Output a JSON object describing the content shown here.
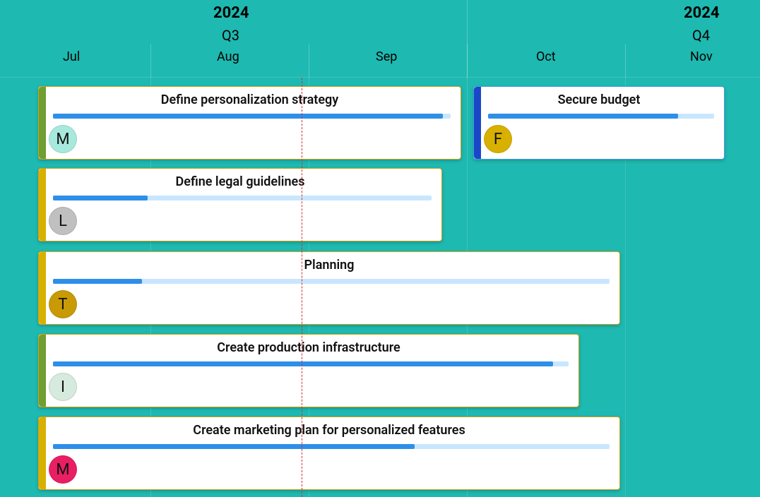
{
  "header": {
    "year_q3": "2024",
    "quarter_q3": "Q3",
    "year_q4": "2024",
    "quarter_q4": "Q4",
    "months": {
      "jul": "Jul",
      "aug": "Aug",
      "sep": "Sep",
      "oct": "Oct",
      "nov": "Nov"
    }
  },
  "tasks": [
    {
      "title": "Define personalization strategy",
      "avatar_letter": "M",
      "avatar_color": "#a7e9dd",
      "edge_color": "#6f9e33",
      "border_color": "#cda312",
      "progress": 98
    },
    {
      "title": "Secure budget",
      "avatar_letter": "F",
      "avatar_color": "#d8b000",
      "edge_color": "#1848c7",
      "border_color": "#4d99e5",
      "progress": 84
    },
    {
      "title": "Define legal guidelines",
      "avatar_letter": "L",
      "avatar_color": "#c0c0c0",
      "edge_color": "#d8b000",
      "border_color": "#cda312",
      "progress": 25
    },
    {
      "title": "Planning",
      "avatar_letter": "T",
      "avatar_color": "#c89a06",
      "edge_color": "#d8b000",
      "border_color": "#cda312",
      "progress": 16
    },
    {
      "title": "Create production infrastructure",
      "avatar_letter": "I",
      "avatar_color": "#d6eadd",
      "edge_color": "#6f9e33",
      "border_color": "#cda312",
      "progress": 97
    },
    {
      "title": "Create marketing plan for personalized features",
      "avatar_letter": "M",
      "avatar_color": "#e91e63",
      "edge_color": "#d8b000",
      "border_color": "#cda312",
      "progress": 65
    }
  ],
  "colors": {
    "bg": "#1eb9b1",
    "progress_fill": "#2d8fe8",
    "progress_track": "#c9e6ff"
  }
}
